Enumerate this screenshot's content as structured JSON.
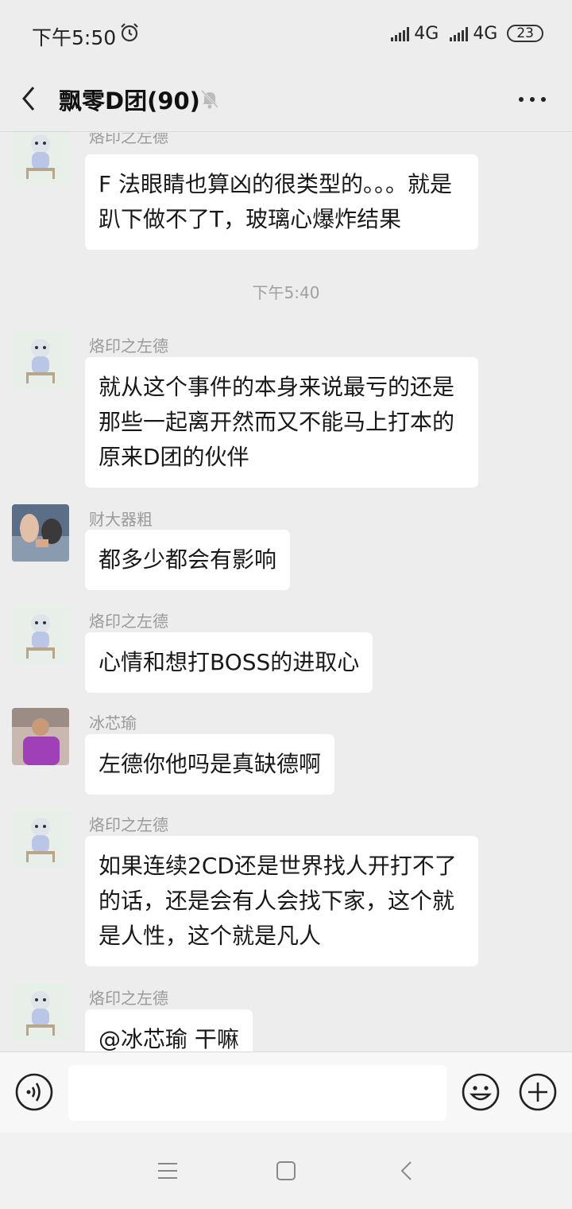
{
  "status": {
    "time": "下午5:50",
    "net1": "4G",
    "net2": "4G",
    "battery": "23"
  },
  "header": {
    "title": "飘零D团(90)"
  },
  "messages": [
    {
      "sender": "烙印之左德",
      "text": "F 法眼睛也算凶的很类型的。。。就是趴下做不了T，玻璃心爆炸结果"
    },
    {
      "timestamp": "下午5:40"
    },
    {
      "sender": "烙印之左德",
      "text": "就从这个事件的本身来说最亏的还是那些一起离开然而又不能马上打本的原来D团的伙伴"
    },
    {
      "sender": "财大器粗",
      "text": "都多少都会有影响"
    },
    {
      "sender": "烙印之左德",
      "text": "心情和想打BOSS的进取心"
    },
    {
      "sender": "冰芯瑜",
      "text": "左德你他吗是真缺德啊"
    },
    {
      "sender": "烙印之左德",
      "text": "如果连续2CD还是世界找人开打不了的话，还是会有人会找下家，这个就是人性，这个就是凡人"
    },
    {
      "sender": "烙印之左德",
      "text": "@冰芯瑜  干嘛"
    }
  ],
  "colors": {
    "background": "#ededed",
    "bubble": "#ffffff",
    "sender": "#9a9a9a"
  },
  "icons": [
    "alarm-icon",
    "back-icon",
    "mute-icon",
    "more-icon",
    "voice-icon",
    "emoji-icon",
    "plus-icon",
    "nav-menu-icon",
    "nav-home-icon",
    "nav-back-icon"
  ]
}
